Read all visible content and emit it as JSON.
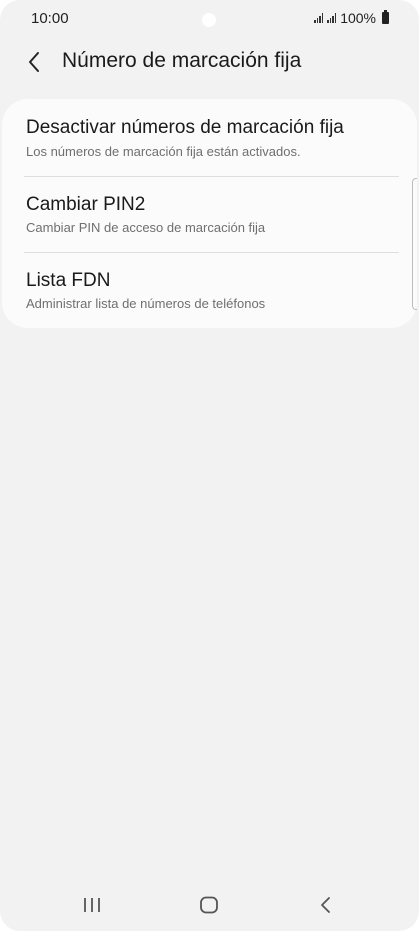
{
  "status_bar": {
    "time": "10:00",
    "battery": "100%",
    "icons": [
      "signal-icon",
      "signal-icon",
      "battery-icon"
    ]
  },
  "header": {
    "back_icon": "chevron-left-icon",
    "title": "Número de marcación fija"
  },
  "menu": {
    "items": [
      {
        "title": "Desactivar números de marcación fija",
        "subtitle": "Los números de marcación fija están activados."
      },
      {
        "title": "Cambiar PIN2",
        "subtitle": "Cambiar PIN de acceso de marcación fija"
      },
      {
        "title": "Lista FDN",
        "subtitle": "Administrar lista de números de teléfonos"
      }
    ]
  },
  "nav_bar": {
    "icons": [
      "recent-apps-icon",
      "home-icon",
      "back-icon"
    ]
  },
  "colors": {
    "background": "#f2f2f2",
    "card": "#fbfbfb",
    "title_text": "#1a1a1a",
    "subtitle_text": "#6f6f6f"
  }
}
